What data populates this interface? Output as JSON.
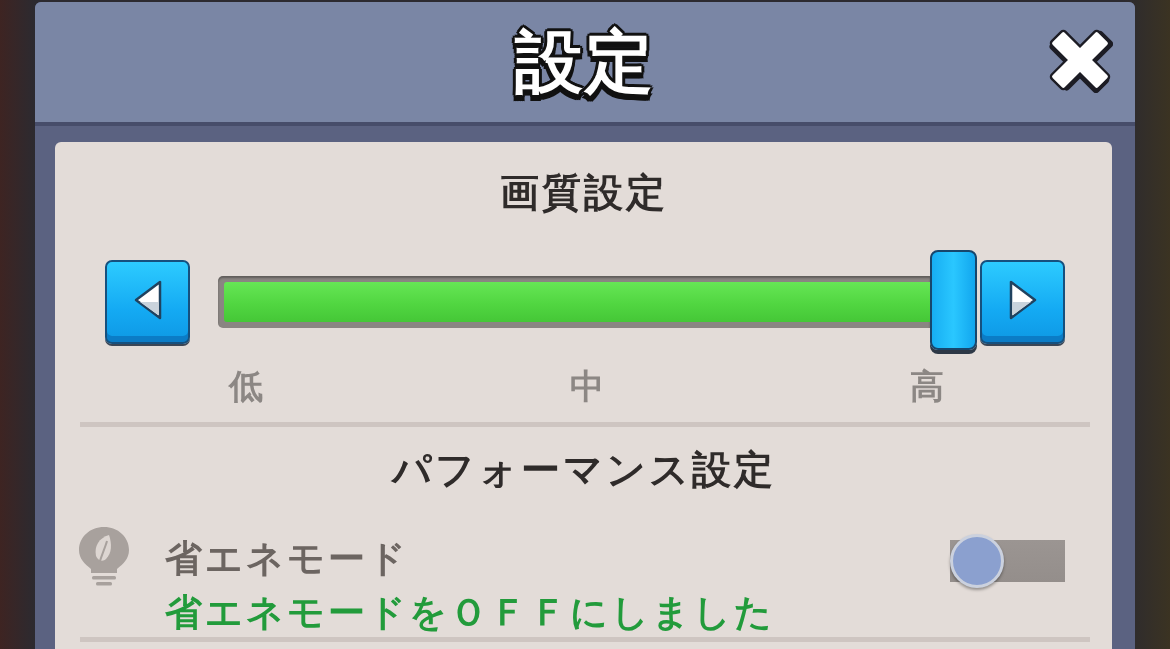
{
  "dialog": {
    "title": "設定"
  },
  "quality": {
    "heading": "画質設定",
    "level": 1,
    "ticks": [
      "低",
      "中",
      "高"
    ]
  },
  "performance": {
    "heading": "パフォーマンス設定",
    "items": [
      {
        "label": "省エネモード",
        "on": false,
        "status": "省エネモードをＯＦＦにしました"
      }
    ]
  }
}
